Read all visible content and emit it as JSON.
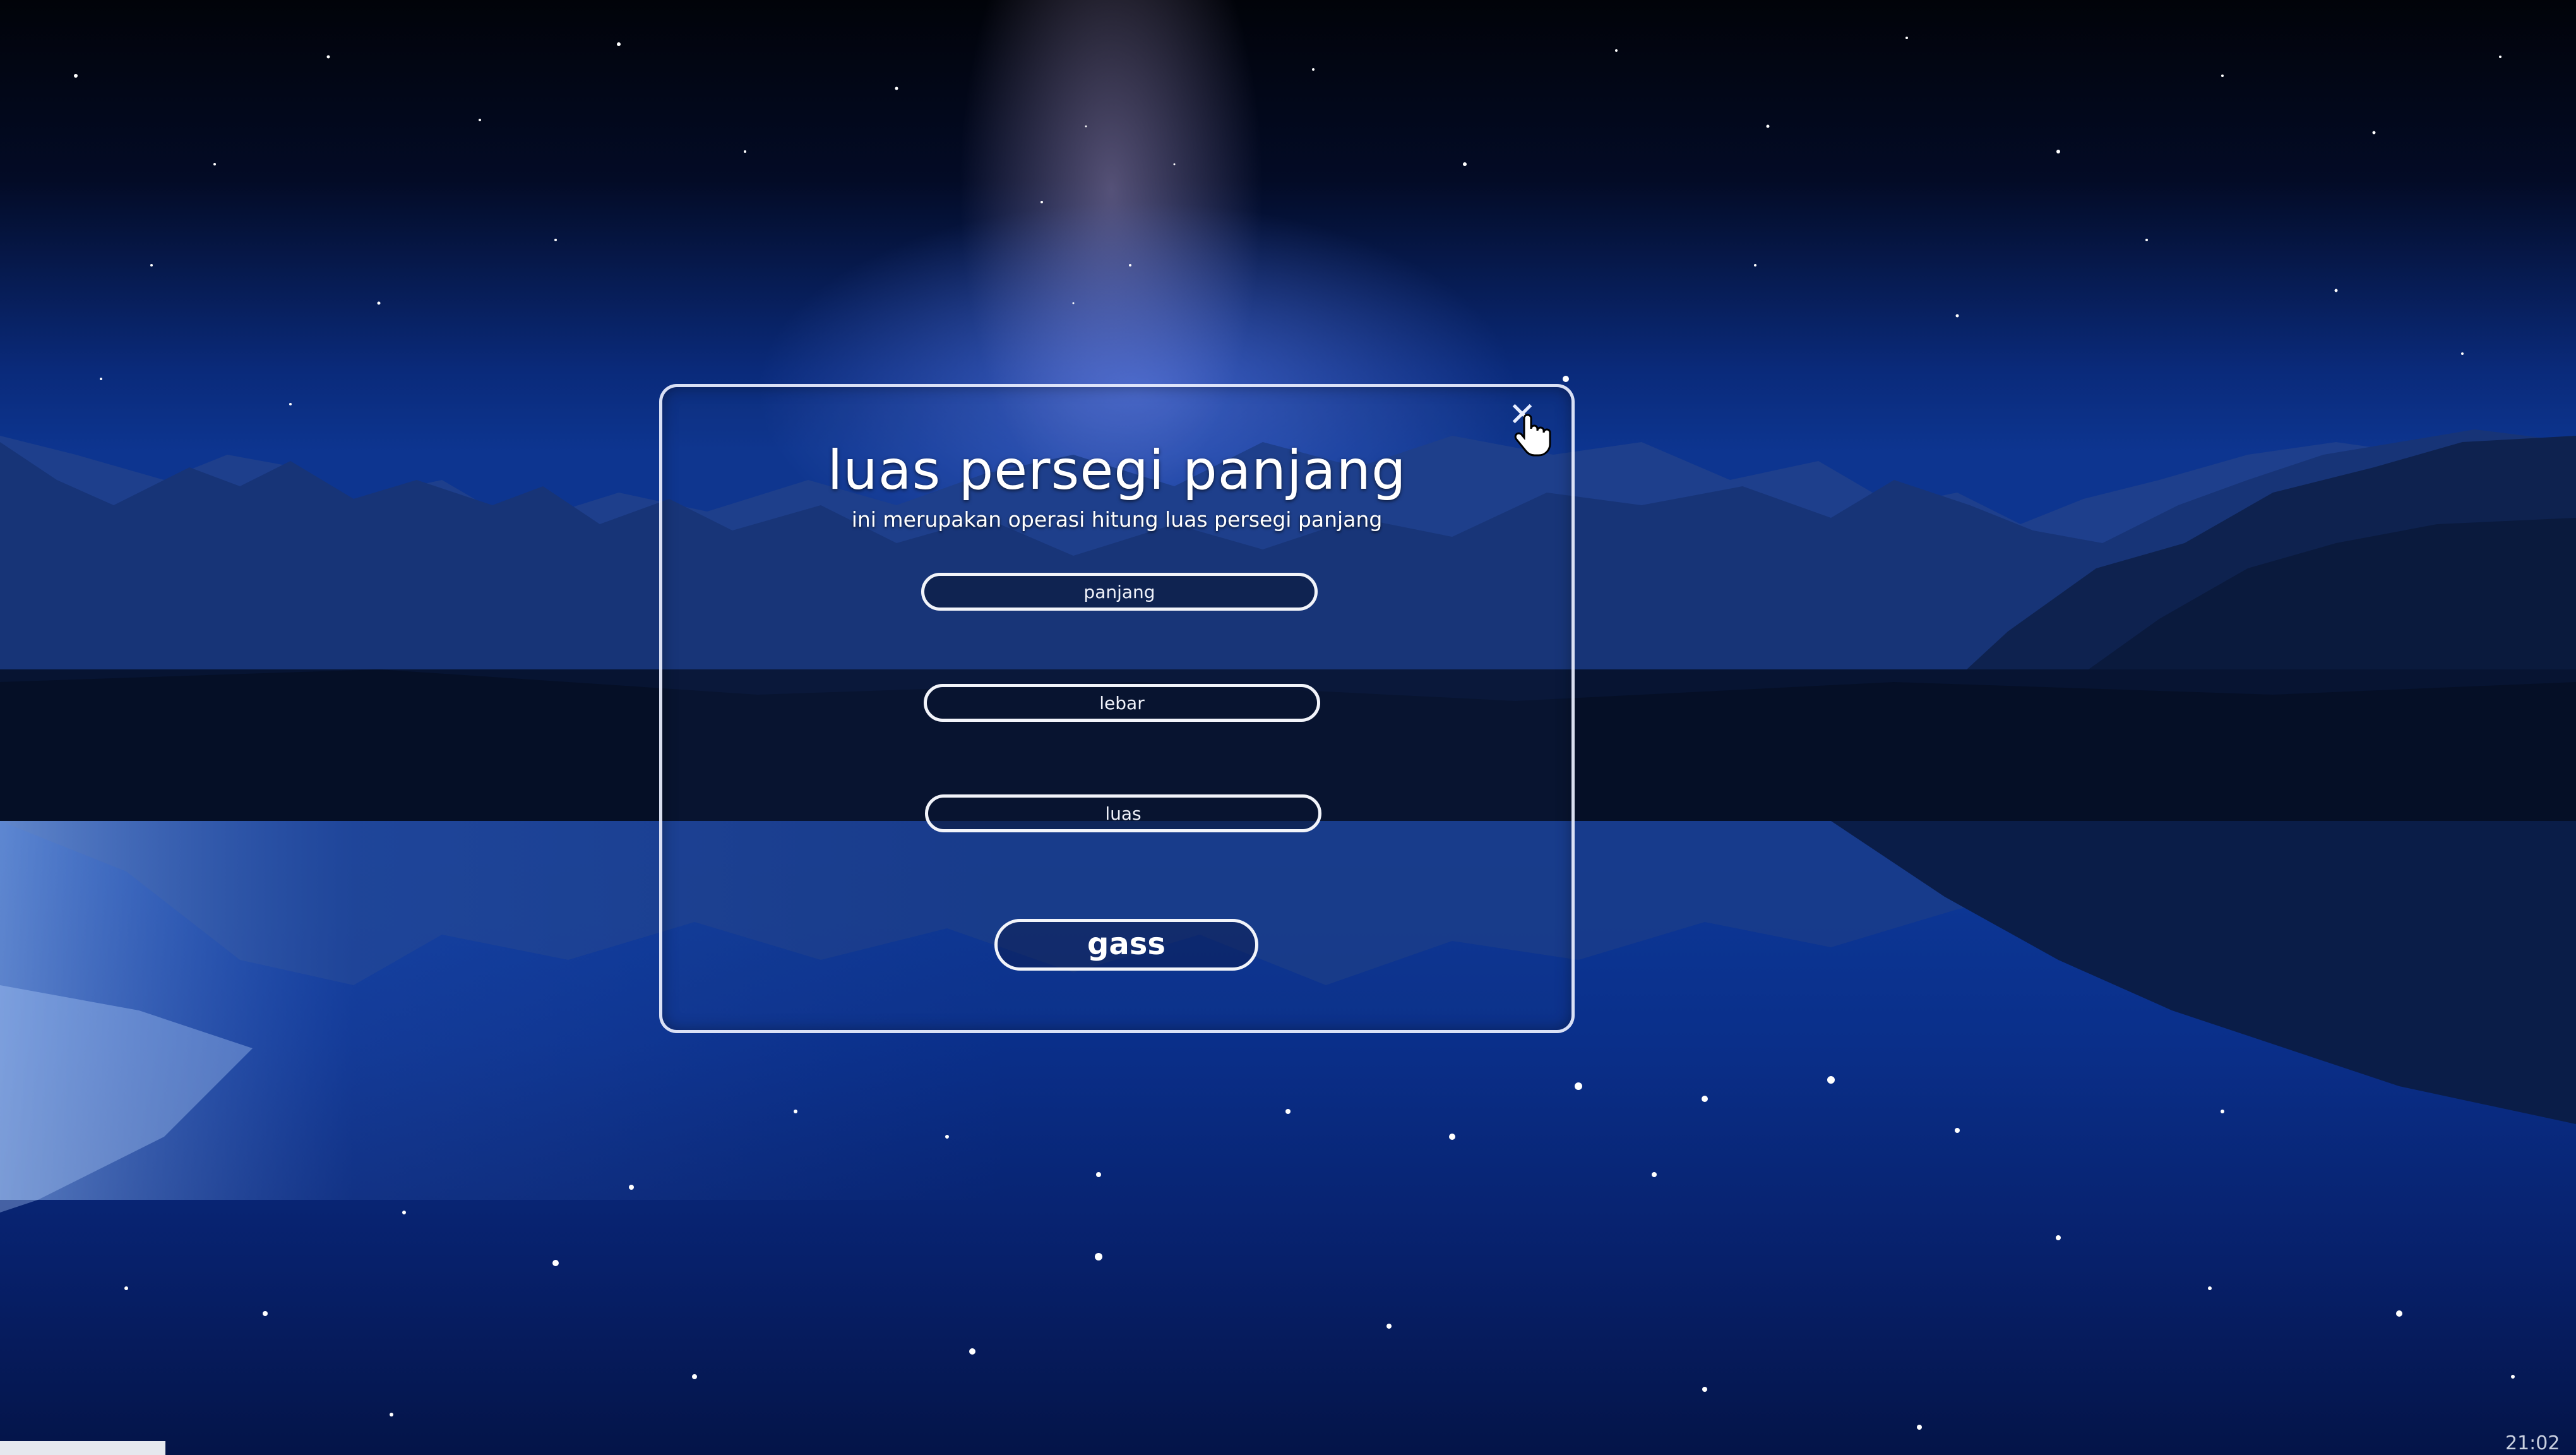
{
  "dialog": {
    "title": "luas persegi panjang",
    "subtitle": "ini merupakan operasi hitung luas persegi panjang",
    "close_symbol": "✕",
    "fields": {
      "panjang_placeholder": "panjang",
      "lebar_placeholder": "lebar",
      "luas_placeholder": "luas"
    },
    "submit_label": "gass"
  },
  "taskbar": {
    "clock": "21:02"
  },
  "icons": {
    "close": "close-icon",
    "cursor": "hand-pointer-icon"
  },
  "colors": {
    "sky_top": "#02050f",
    "sky_mid": "#0a2a7a",
    "water": "#0e3fa0",
    "dialog_border": "#ebf0ff"
  }
}
